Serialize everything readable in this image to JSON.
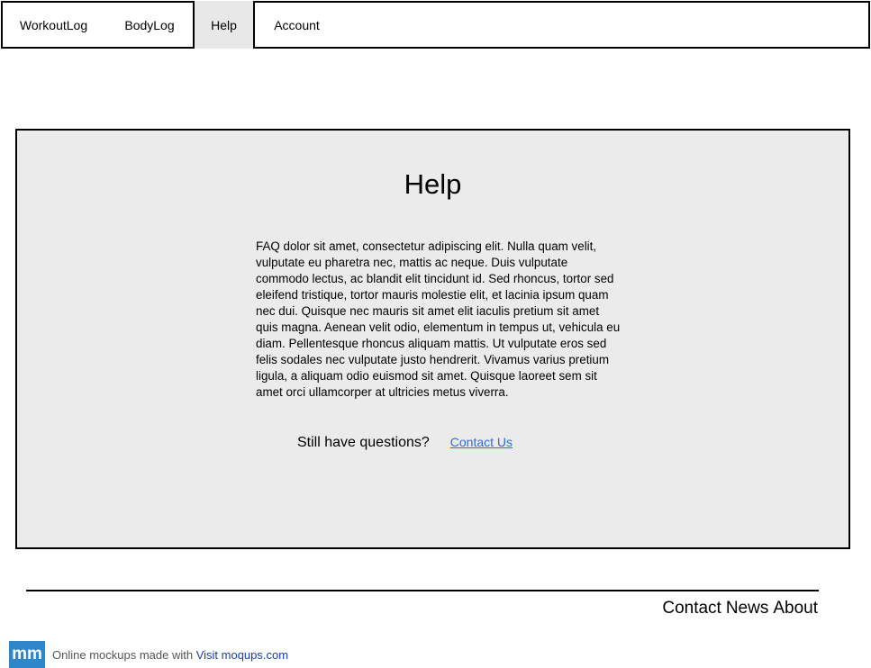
{
  "nav": {
    "items": [
      {
        "label": "WorkoutLog"
      },
      {
        "label": "BodyLog"
      },
      {
        "label": "Help"
      },
      {
        "label": "Account"
      }
    ]
  },
  "main": {
    "title": "Help",
    "faq_text": "FAQ dolor sit amet, consectetur adipiscing elit. Nulla quam velit, vulputate eu pharetra nec, mattis ac neque. Duis vulputate commodo lectus, ac blandit elit tincidunt id. Sed rhoncus, tortor sed eleifend tristique, tortor mauris molestie elit, et lacinia ipsum quam nec dui. Quisque nec mauris sit amet elit iaculis pretium sit amet quis magna. Aenean velit odio, elementum in tempus ut, vehicula eu diam. Pellentesque rhoncus aliquam mattis. Ut vulputate eros sed felis sodales nec vulputate justo hendrerit. Vivamus varius pretium ligula, a aliquam odio euismod sit amet. Quisque laoreet sem sit amet orci ullamcorper at ultricies metus viverra.",
    "questions_label": "Still have questions?",
    "contact_link": "Contact Us"
  },
  "footer": {
    "links": [
      "Contact",
      "News",
      "About"
    ]
  },
  "promo": {
    "logo_text": "mm",
    "text": "Online mockups made with",
    "link_text": "Visit moqups.com"
  }
}
